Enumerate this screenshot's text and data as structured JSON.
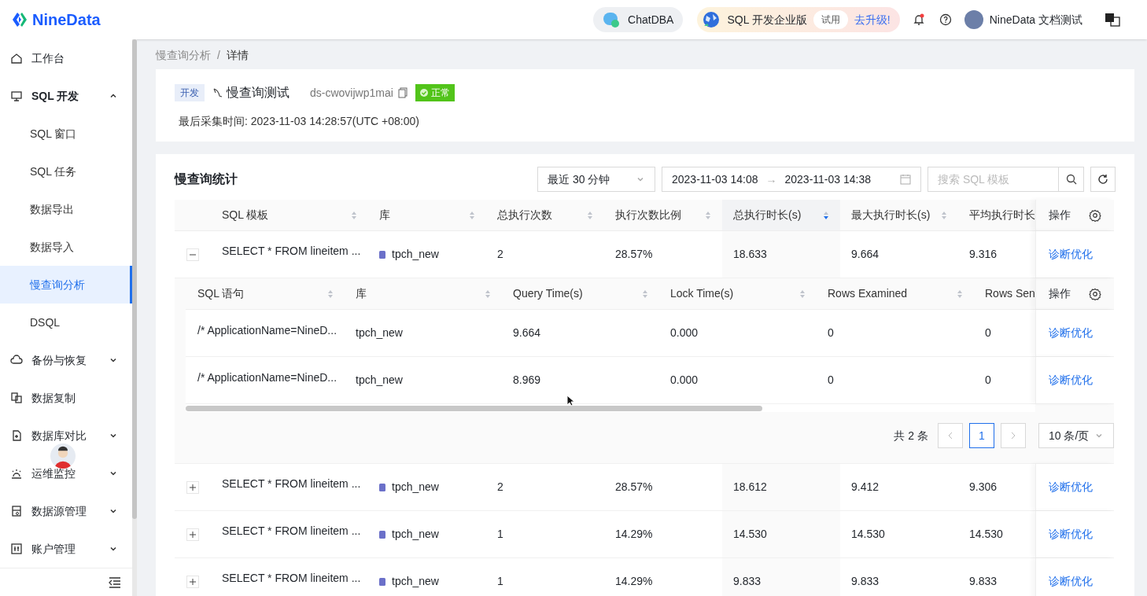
{
  "header": {
    "logo": "NineData",
    "chatdba": "ChatDBA",
    "edition": {
      "label": "SQL 开发企业版",
      "badge": "试用",
      "upgrade": "去升级!"
    },
    "notifications": {
      "unread": true
    },
    "user": "NineData 文档测试"
  },
  "sidebar": {
    "items": [
      {
        "label": "工作台",
        "selected": false
      },
      {
        "label": "SQL 开发",
        "selected": false,
        "expanded": true,
        "children": [
          {
            "label": "SQL 窗口",
            "selected": false
          },
          {
            "label": "SQL 任务",
            "selected": false
          },
          {
            "label": "数据导出",
            "selected": false
          },
          {
            "label": "数据导入",
            "selected": false
          },
          {
            "label": "慢查询分析",
            "selected": true
          },
          {
            "label": "DSQL",
            "selected": false
          }
        ]
      },
      {
        "label": "备份与恢复",
        "selected": false,
        "expanded": false
      },
      {
        "label": "数据复制",
        "selected": false
      },
      {
        "label": "数据库对比",
        "selected": false,
        "expanded": false
      },
      {
        "label": "运维监控",
        "selected": false,
        "expanded": false
      },
      {
        "label": "数据源管理",
        "selected": false,
        "expanded": false
      },
      {
        "label": "账户管理",
        "selected": false,
        "expanded": false
      }
    ]
  },
  "breadcrumb": {
    "items": [
      "慢查询分析",
      "详情"
    ],
    "separator": "/"
  },
  "datasource": {
    "env": "开发",
    "name": "慢查询测试",
    "id": "ds-cwovijwp1mai",
    "status": "正常",
    "last_collected": "最后采集时间: 2023-11-03 14:28:57(UTC +08:00)"
  },
  "stats": {
    "title": "慢查询统计",
    "range": "最近 30 分钟",
    "start": "2023-11-03 14:08",
    "date_separator": "→",
    "end": "2023-11-03 14:38",
    "search_placeholder": "搜索 SQL 模板",
    "columns": [
      {
        "label": "SQL 模板",
        "sorted": false
      },
      {
        "label": "库",
        "sorted": false
      },
      {
        "label": "总执行次数",
        "sorted": false
      },
      {
        "label": "执行次数比例",
        "sorted": false
      },
      {
        "label": "总执行时长(s)",
        "sorted": true
      },
      {
        "label": "最大执行时长(s)",
        "sorted": false
      },
      {
        "label": "平均执行时长"
      }
    ],
    "action_column": "操作",
    "rows": [
      {
        "expanded": true,
        "cells": [
          "SELECT * FROM lineitem ...",
          "tpch_new",
          "2",
          "28.57%",
          "18.633",
          "9.664",
          "9.316"
        ],
        "action": "诊断优化",
        "detail": {
          "columns": [
            {
              "label": "SQL 语句",
              "sorted": false
            },
            {
              "label": "库",
              "sorted": false
            },
            {
              "label": "Query Time(s)",
              "sorted": false
            },
            {
              "label": "Lock Time(s)",
              "sorted": false
            },
            {
              "label": "Rows Examined",
              "sorted": false
            },
            {
              "label": "Rows Sen"
            }
          ],
          "action_column": "操作",
          "rows": [
            {
              "cells": [
                "/* ApplicationName=NineD...",
                "tpch_new",
                "9.664",
                "0.000",
                "0",
                "0"
              ],
              "action": "诊断优化"
            },
            {
              "cells": [
                "/* ApplicationName=NineD...",
                "tpch_new",
                "8.969",
                "0.000",
                "0",
                "0"
              ],
              "action": "诊断优化"
            }
          ],
          "total": "共 2 条",
          "pages": [
            {
              "label": "1",
              "selected": true
            }
          ],
          "page_size": "10 条/页"
        }
      },
      {
        "expanded": false,
        "cells": [
          "SELECT * FROM lineitem ...",
          "tpch_new",
          "2",
          "28.57%",
          "18.612",
          "9.412",
          "9.306"
        ],
        "action": "诊断优化"
      },
      {
        "expanded": false,
        "cells": [
          "SELECT * FROM lineitem ...",
          "tpch_new",
          "1",
          "14.29%",
          "14.530",
          "14.530",
          "14.530"
        ],
        "action": "诊断优化"
      },
      {
        "expanded": false,
        "cells": [
          "SELECT * FROM lineitem ...",
          "tpch_new",
          "1",
          "14.29%",
          "9.833",
          "9.833",
          "9.833"
        ],
        "action": "诊断优化"
      }
    ]
  }
}
